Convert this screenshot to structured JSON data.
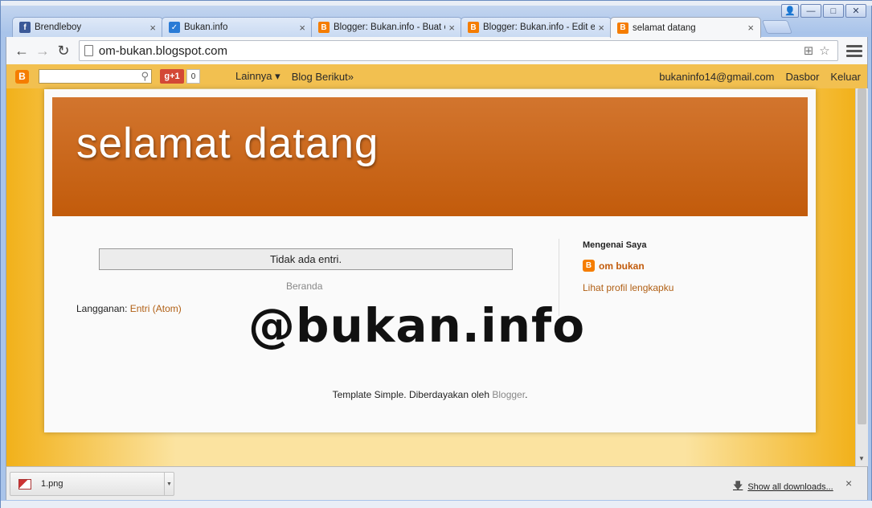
{
  "browser": {
    "tabs": [
      {
        "title": "Brendleboy",
        "icon": "facebook-icon",
        "active": false
      },
      {
        "title": "Bukan.info",
        "icon": "checkbox-icon",
        "active": false
      },
      {
        "title": "Blogger: Bukan.info - Buat e",
        "icon": "blogger-icon",
        "active": false
      },
      {
        "title": "Blogger: Bukan.info - Edit er",
        "icon": "blogger-icon",
        "active": false
      },
      {
        "title": "selamat datang",
        "icon": "blogger-icon",
        "active": true
      }
    ],
    "tab_close_glyph": "×",
    "url": "om-bukan.blogspot.com",
    "back_glyph": "←",
    "forward_glyph": "→",
    "reload_glyph": "↻",
    "translate_glyph": "⊞",
    "star_glyph": "☆"
  },
  "blogger_navbar": {
    "logo_letter": "B",
    "search_placeholder": "",
    "gplus_label": "g+1",
    "gplus_count": "0",
    "more_label": "Lainnya ▾",
    "next_blog_label": "Blog Berikut»",
    "user_email": "bukaninfo14@gmail.com",
    "dashboard_label": "Dasbor",
    "logout_label": "Keluar"
  },
  "blog": {
    "header_title": "selamat datang",
    "no_posts": "Tidak ada entri.",
    "home_link": "Beranda",
    "subscribe_label": "Langganan: ",
    "subscribe_link": "Entri (Atom)",
    "about_heading": "Mengenai Saya",
    "author_name": "om bukan",
    "profile_link": "Lihat profil lengkapku",
    "watermark": "@bukan.info",
    "footer_text": "Template Simple. Diberdayakan oleh ",
    "footer_link": "Blogger",
    "footer_end": "."
  },
  "downloads": {
    "file_name": "1.png",
    "show_all": "Show all downloads...",
    "close_glyph": "×"
  },
  "colors": {
    "banner_top": "#d2752e",
    "banner_bottom": "#c25b0b",
    "navbar": "#f2c050",
    "link": "#b05f14",
    "blogger_orange": "#f57d00"
  }
}
